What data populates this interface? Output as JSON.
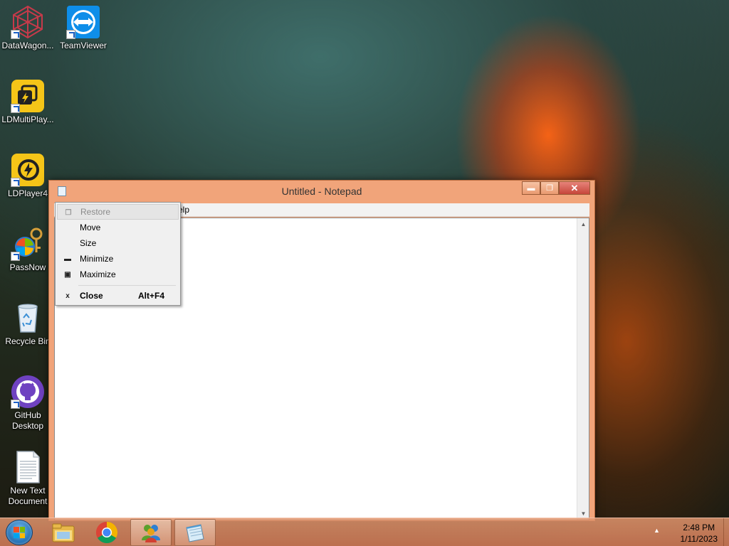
{
  "desktop": {
    "icons": [
      {
        "label": "DataWagon...",
        "icon": "datawagon-icon"
      },
      {
        "label": "TeamViewer",
        "icon": "teamviewer-icon"
      },
      {
        "label": "LDMultiPlay...",
        "icon": "ldmultiplayer-icon"
      },
      {
        "label": "LDPlayer4",
        "icon": "ldplayer-icon"
      },
      {
        "label": "PassNow",
        "icon": "passnow-icon"
      },
      {
        "label": "Recycle Bin",
        "icon": "recycle-bin-icon"
      },
      {
        "label": "GitHub Desktop",
        "line1": "GitHub",
        "line2": "Desktop",
        "icon": "github-icon"
      },
      {
        "label": "New Text Document",
        "line1": "New Text",
        "line2": "Document",
        "icon": "text-document-icon"
      }
    ]
  },
  "window": {
    "title": "Untitled - Notepad",
    "menu_partial": "elp",
    "caption": {
      "minimize": "minimize-icon",
      "restore": "restore-icon",
      "close": "close-icon"
    }
  },
  "system_menu": {
    "items": [
      {
        "label": "Restore",
        "disabled": true,
        "glyph": "restore-icon"
      },
      {
        "label": "Move"
      },
      {
        "label": "Size"
      },
      {
        "label": "Minimize",
        "glyph": "minimize-icon"
      },
      {
        "label": "Maximize",
        "glyph": "maximize-icon"
      },
      {
        "label": "Close",
        "shortcut": "Alt+F4",
        "bold": true,
        "glyph": "close-icon"
      }
    ]
  },
  "taskbar": {
    "pinned": [
      "file-explorer-icon",
      "chrome-icon",
      "people-app-icon",
      "notepad-icon"
    ],
    "clock": {
      "time": "2:48 PM",
      "date": "1/11/2023"
    }
  },
  "colors": {
    "window_frame": "#f1a47a",
    "taskbar": "#d58a63"
  }
}
